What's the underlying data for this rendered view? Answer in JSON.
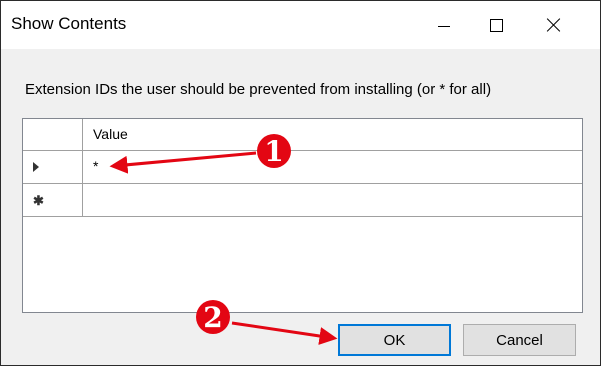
{
  "window": {
    "title": "Show Contents"
  },
  "dialog": {
    "instruction": "Extension IDs the user should be prevented from installing (or * for all)",
    "grid": {
      "column_header": "Value",
      "rows": [
        {
          "value": "*",
          "state": "current"
        },
        {
          "value": "",
          "state": "new"
        }
      ]
    },
    "buttons": {
      "ok": "OK",
      "cancel": "Cancel"
    }
  },
  "annotations": [
    {
      "number": "1",
      "points_to": "grid-row-1-value"
    },
    {
      "number": "2",
      "points_to": "ok-button"
    }
  ],
  "colors": {
    "annotation_red": "#e30613",
    "focus_blue": "#0078d7"
  }
}
